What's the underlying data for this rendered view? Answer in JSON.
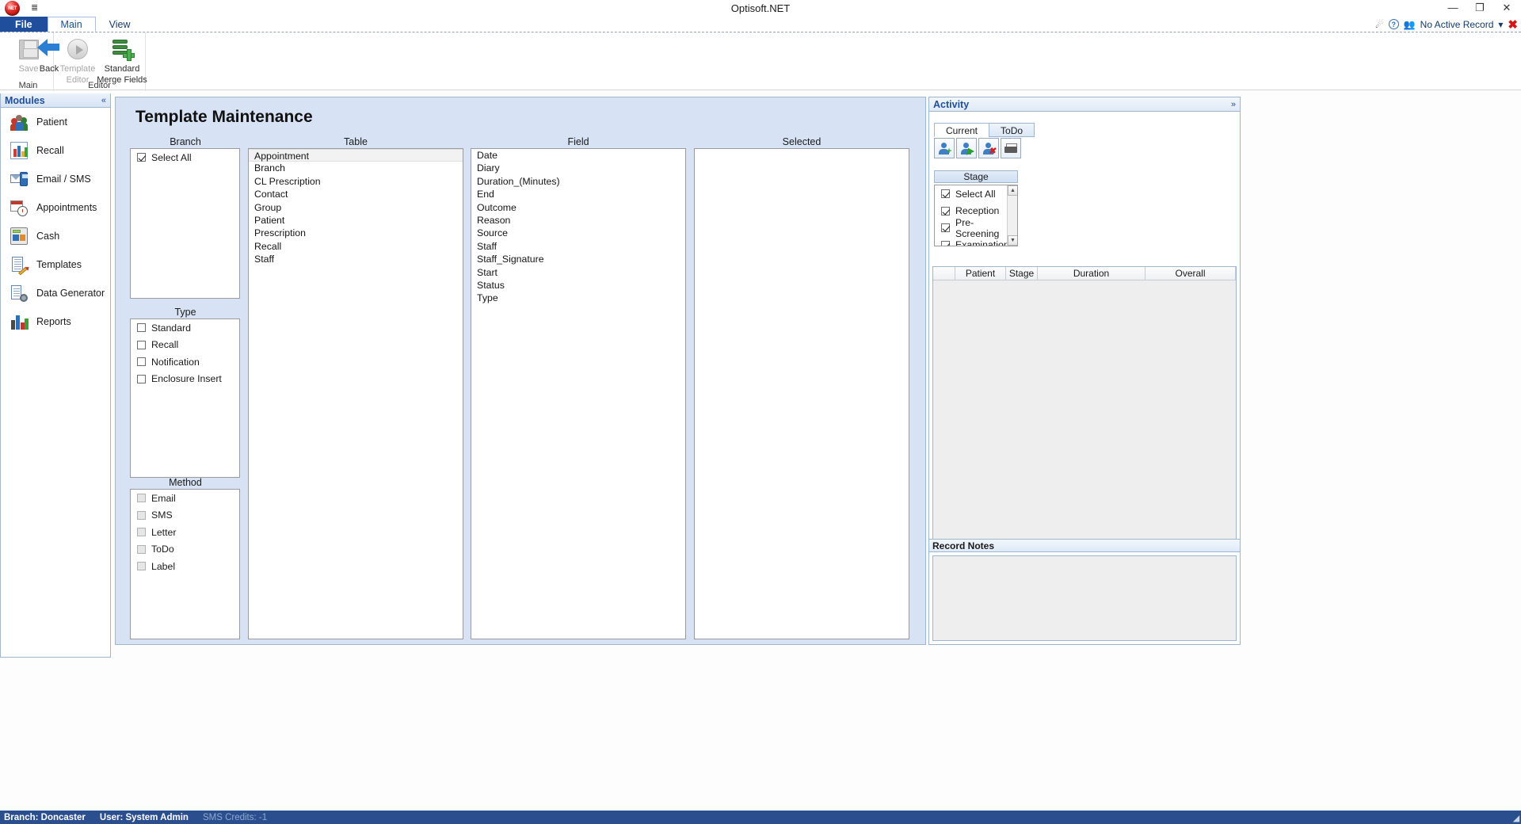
{
  "window": {
    "title": "Optisoft.NET",
    "logo_text": "NET",
    "qat_icon": "customize-quick-access-toolbar-icon",
    "buttons": {
      "minimize": "—",
      "restore": "❐",
      "close": "✕"
    }
  },
  "ribbon": {
    "tabs": [
      {
        "label": "File",
        "style": "file"
      },
      {
        "label": "Main",
        "style": "active"
      },
      {
        "label": "View",
        "style": "normal"
      }
    ],
    "topright": {
      "home_icon": "home-icon",
      "help_icon": "help-icon",
      "people_icon": "people-icon",
      "record_label": "No Active Record",
      "dropdown_caret": "▾",
      "close_icon": "close-record-icon"
    },
    "groups": [
      {
        "label": "Main",
        "buttons": [
          {
            "label_line1": "Save",
            "label_line2": "",
            "icon": "floppy-disk-icon",
            "disabled": true
          },
          {
            "label_line1": "Back",
            "label_line2": "",
            "icon": "back-arrow-icon",
            "disabled": false
          }
        ]
      },
      {
        "label": "Editor",
        "buttons": [
          {
            "label_line1": "Template",
            "label_line2": "Editor",
            "icon": "play-circle-icon",
            "disabled": true
          },
          {
            "label_line1": "Standard",
            "label_line2": "Merge Fields",
            "icon": "database-add-icon",
            "disabled": false
          }
        ]
      }
    ]
  },
  "sidebar": {
    "title": "Modules",
    "collapse_icon": "«",
    "items": [
      {
        "label": "Patient",
        "icon": "patient-icon"
      },
      {
        "label": "Recall",
        "icon": "recall-chart-icon"
      },
      {
        "label": "Email / SMS",
        "icon": "email-sms-icon"
      },
      {
        "label": "Appointments",
        "icon": "appointments-calendar-clock-icon"
      },
      {
        "label": "Cash",
        "icon": "cash-register-icon"
      },
      {
        "label": "Templates",
        "icon": "templates-document-pencil-icon"
      },
      {
        "label": "Data Generator",
        "icon": "data-generator-icon"
      },
      {
        "label": "Reports",
        "icon": "reports-bar-chart-icon"
      }
    ]
  },
  "main": {
    "title": "Template Maintenance",
    "columns": {
      "branch": "Branch",
      "table": "Table",
      "field": "Field",
      "selected": "Selected"
    },
    "branch_list": [
      {
        "label": "Select All",
        "checked": true
      }
    ],
    "table_list": [
      {
        "label": "Appointment",
        "selected": true
      },
      {
        "label": "Branch",
        "selected": false
      },
      {
        "label": "CL Prescription",
        "selected": false
      },
      {
        "label": "Contact",
        "selected": false
      },
      {
        "label": "Group",
        "selected": false
      },
      {
        "label": "Patient",
        "selected": false
      },
      {
        "label": "Prescription",
        "selected": false
      },
      {
        "label": "Recall",
        "selected": false
      },
      {
        "label": "Staff",
        "selected": false
      }
    ],
    "field_list": [
      "Date",
      "Diary",
      "Duration_(Minutes)",
      "End",
      "Outcome",
      "Reason",
      "Source",
      "Staff",
      "Staff_Signature",
      "Start",
      "Status",
      "Type"
    ],
    "selected_list": [],
    "type": {
      "label": "Type",
      "items": [
        {
          "label": "Standard",
          "checked": false,
          "disabled": false
        },
        {
          "label": "Recall",
          "checked": false,
          "disabled": false
        },
        {
          "label": "Notification",
          "checked": false,
          "disabled": false
        },
        {
          "label": "Enclosure Insert",
          "checked": false,
          "disabled": false
        }
      ]
    },
    "method": {
      "label": "Method",
      "items": [
        {
          "label": "Email",
          "checked": false,
          "disabled": true
        },
        {
          "label": "SMS",
          "checked": false,
          "disabled": true
        },
        {
          "label": "Letter",
          "checked": false,
          "disabled": true
        },
        {
          "label": "ToDo",
          "checked": false,
          "disabled": true
        },
        {
          "label": "Label",
          "checked": false,
          "disabled": true
        }
      ]
    }
  },
  "activity": {
    "title": "Activity",
    "expand_icon": "»",
    "tabs": [
      {
        "label": "Current",
        "active": true
      },
      {
        "label": "ToDo",
        "active": false
      }
    ],
    "toolbar": [
      {
        "icon": "add-person-icon",
        "badge": "+",
        "badge_color": "#2e9e2e"
      },
      {
        "icon": "move-person-icon",
        "badge": "▶",
        "badge_color": "#2e9e2e"
      },
      {
        "icon": "remove-person-icon",
        "badge": "✕",
        "badge_color": "#cf2222"
      },
      {
        "icon": "printer-icon",
        "badge": "",
        "badge_color": ""
      }
    ],
    "stage": {
      "label": "Stage",
      "items": [
        {
          "label": "Select All",
          "checked": true
        },
        {
          "label": "Reception",
          "checked": true
        },
        {
          "label": "Pre-Screening",
          "checked": true
        },
        {
          "label": "Examination",
          "checked": true
        }
      ],
      "scroll_up": "▲",
      "scroll_down": "▼"
    },
    "grid": {
      "headers": [
        "",
        "Patient",
        "Stage",
        "Duration",
        "Overall"
      ],
      "rows": []
    },
    "record_notes": {
      "label": "Record Notes",
      "body": ""
    }
  },
  "statusbar": {
    "branch": "Branch: Doncaster",
    "user": "User: System Admin",
    "sms_credits": "SMS Credits: -1",
    "resizer_icon": "resize-grip-icon"
  }
}
